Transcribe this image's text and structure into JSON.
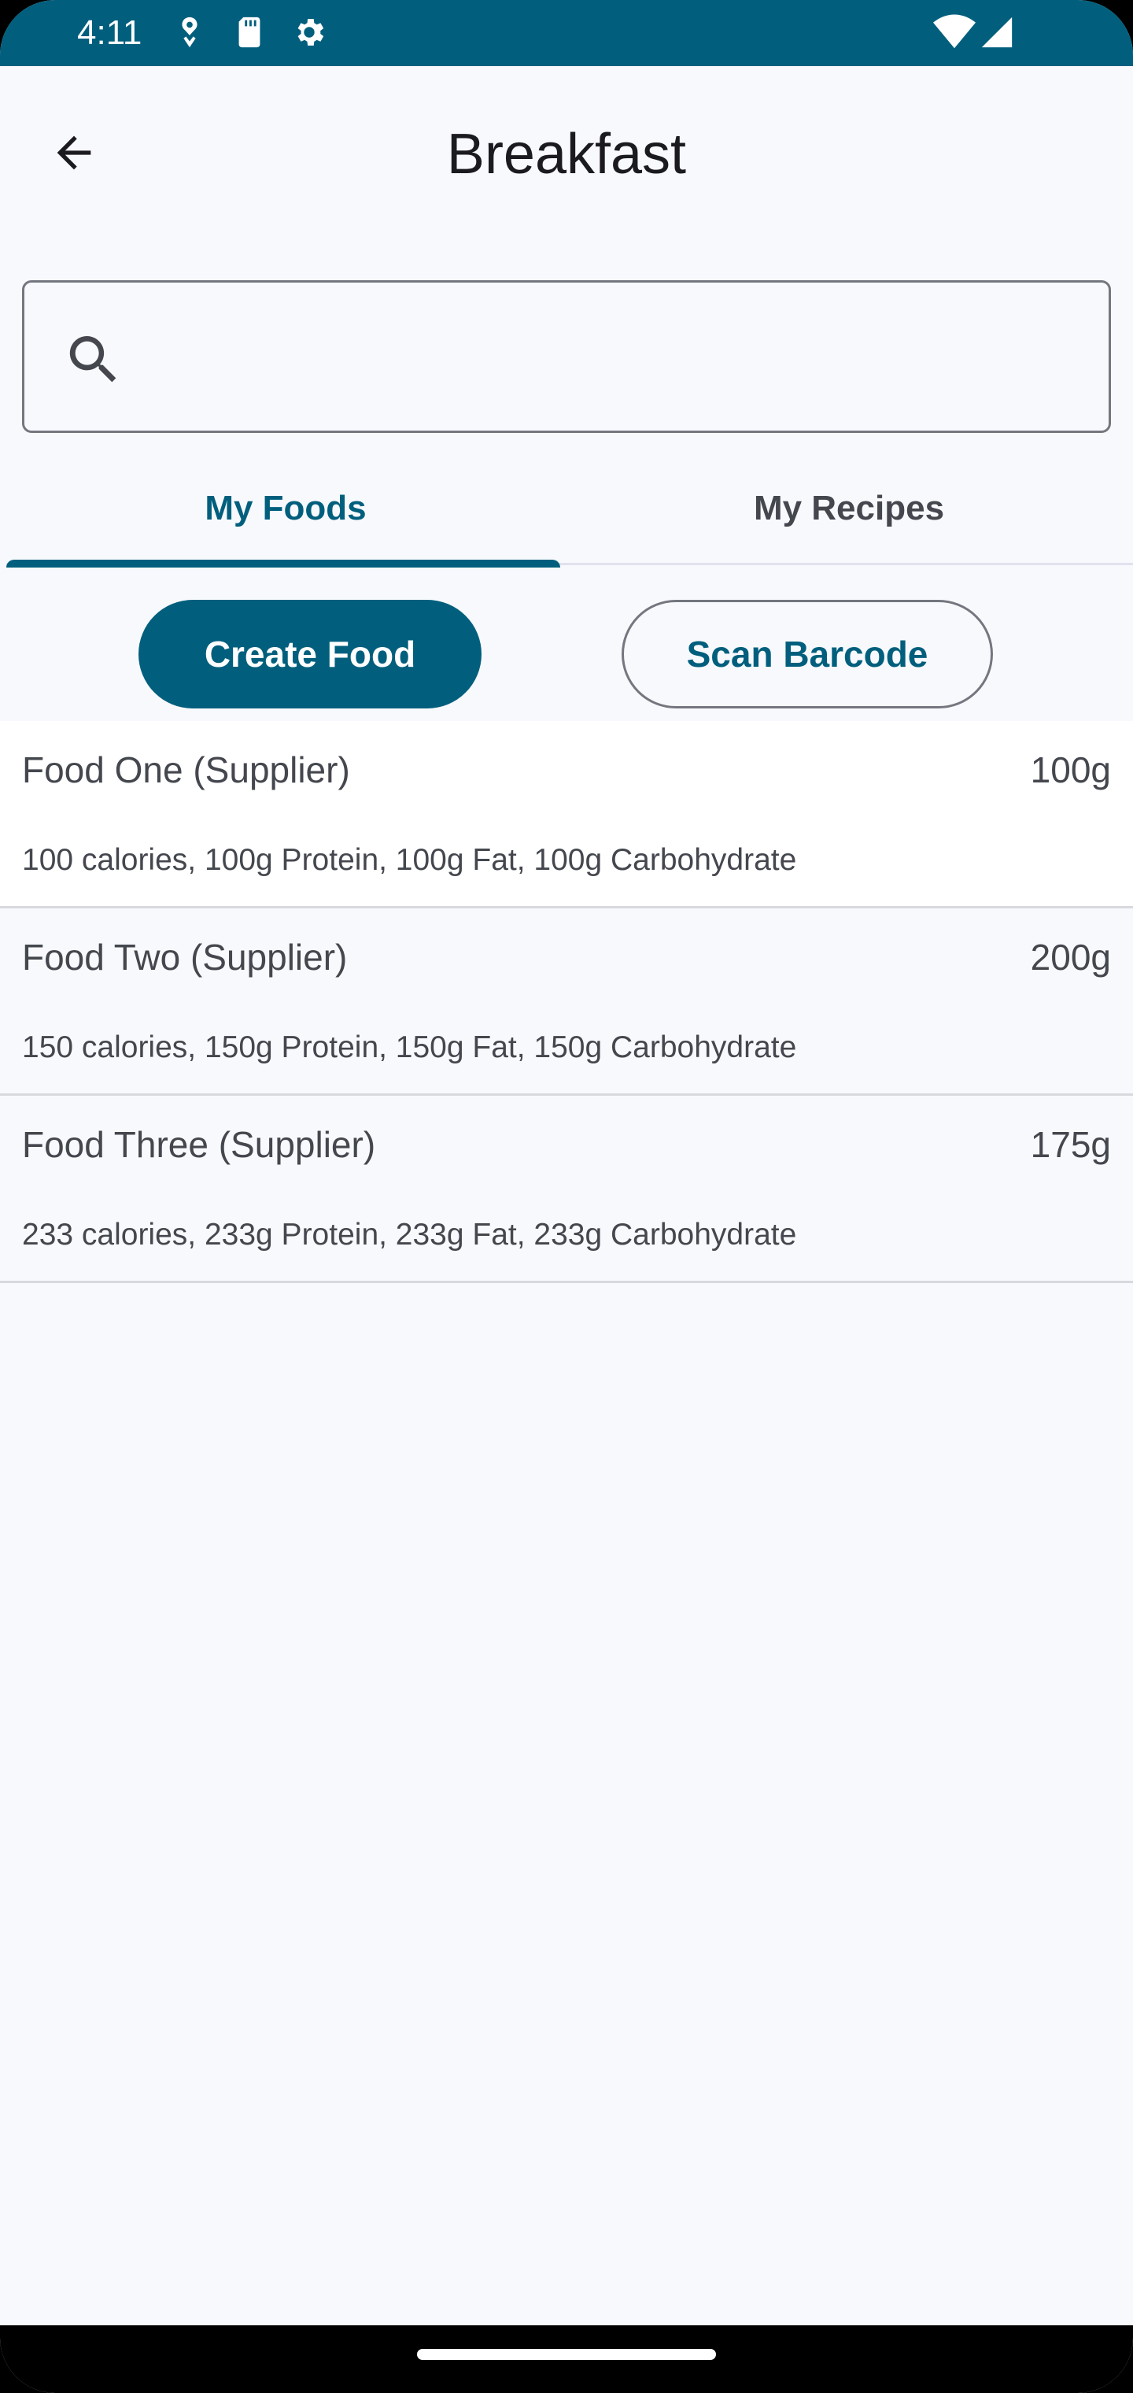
{
  "status_bar": {
    "time": "4:11",
    "background_color": "#015f7d",
    "left_icons": [
      "location-icon",
      "sd-card-icon",
      "settings-gear-icon"
    ],
    "right_icons": [
      "wifi-icon",
      "signal-icon"
    ]
  },
  "app_bar": {
    "back_icon": "arrow-back-icon",
    "title": "Breakfast"
  },
  "search": {
    "icon": "search-icon",
    "value": "",
    "placeholder": ""
  },
  "tabs": [
    {
      "label": "My Foods",
      "selected": true
    },
    {
      "label": "My Recipes",
      "selected": false
    }
  ],
  "actions": {
    "create_label": "Create Food",
    "scan_label": "Scan Barcode"
  },
  "foods": [
    {
      "name": "Food One (Supplier)",
      "amount": "100g",
      "macros": "100 calories, 100g Protein, 100g Fat, 100g Carbohydrate"
    },
    {
      "name": "Food Two (Supplier)",
      "amount": "200g",
      "macros": "150 calories, 150g Protein, 150g Fat, 150g Carbohydrate"
    },
    {
      "name": "Food Three (Supplier)",
      "amount": "175g",
      "macros": "233 calories, 233g Protein, 233g Fat, 233g Carbohydrate"
    }
  ],
  "colors": {
    "primary": "#015f7d",
    "background": "#f8f9fc",
    "text": "#44474e",
    "outline": "#74777f"
  }
}
